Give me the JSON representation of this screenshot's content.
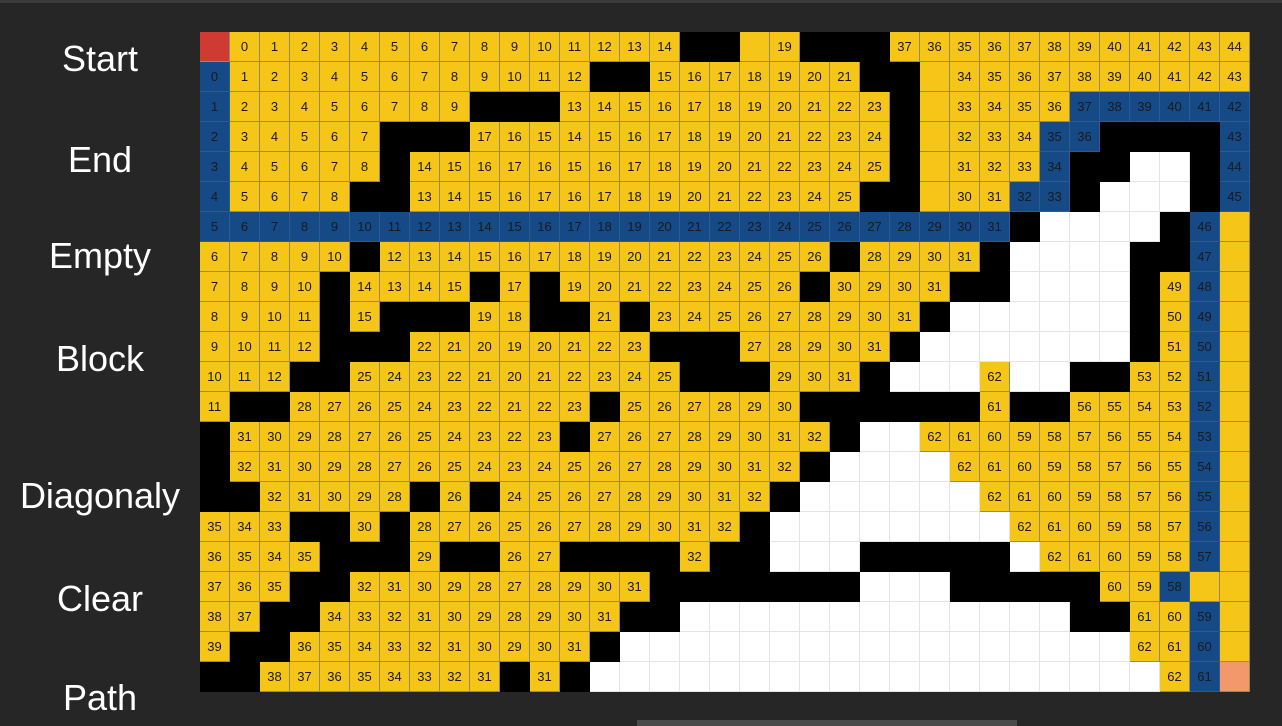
{
  "sidebar": {
    "start_label": "Start",
    "end_label": "End",
    "empty_label": "Empty",
    "block_label": "Block",
    "diagonaly_label": "Diagonaly",
    "clear_label": "Clear",
    "path_label": "Path"
  },
  "colors": {
    "empty": "#f5c518",
    "block": "#000000",
    "clear": "#ffffff",
    "path": "#154a86",
    "start": "#cf3a33",
    "end": "#f2986a",
    "background": "#262626"
  },
  "grid": {
    "cols": 35,
    "rows": 22,
    "legend": "S=start E=end #=block .=clear P=path-cell (value in path_values) otherwise number=empty cell with distance; values separated by commas",
    "cells": [
      "S,0,1,2,3,4,5,6,7,8,9,10,11,12,13,14,#,#,,19,#,#,#,37,36,35,36,37,38,39,40,41,42,43,44",
      "P0,1,2,3,4,5,6,7,8,9,10,11,12,#,#,15,16,17,18,19,20,21,#,#,,34,35,36,37,38,39,40,41,42,43,",
      "P1,2,3,4,5,6,7,8,9,#,#,#,13,14,15,16,17,18,19,20,21,22,23,#,,33,34,35,36,P37,P38,P39,P40,P41,P42,",
      "P2,3,4,5,6,7,#,#,#,17,16,15,14,15,16,17,18,19,20,21,22,23,24,#,,32,33,34,P35,P36,#,#,#,#,P43,",
      "P3,4,5,6,7,8,#,14,15,16,17,16,15,16,17,18,19,20,21,22,23,24,25,#,,31,32,33,P34,#,#,.,.,#,P44,",
      "P4,5,6,7,8,#,#,13,14,15,16,17,16,17,18,19,20,21,22,23,24,25,#,#,,30,31,P32,P33,#,.,.,.,#,P45,",
      "P5,P6,P7,P8,P9,P10,P11,P12,P13,P14,P15,P16,P17,P18,P19,P20,P21,P22,P23,P24,P25,P26,P27,P28,P29,P30,P31,#,.,.,.,.,#,P46,",
      "6,7,8,9,10,#,12,13,14,15,16,17,18,19,20,21,22,23,24,25,26,#,28,29,30,31,#,.,.,.,.,#,#,P47,",
      "7,8,9,10,#,14,13,14,15,#,17,#,19,20,21,22,23,24,25,26,#,30,29,30,31,#,#,.,.,.,.,#,49,P48,",
      "8,9,10,11,#,15,#,#,#,19,18,#,#,21,#,23,24,25,26,27,28,29,30,31,#,.,.,.,.,.,.,#,50,P49,",
      "9,10,11,12,#,#,#,22,21,20,19,20,21,22,23,#,#,#,27,28,29,30,31,#,.,.,.,.,.,.,.,#,51,P50,",
      "10,11,12,#,#,25,24,23,22,21,20,21,22,23,24,25,#,#,#,29,30,31,#,.,.,.,62,.,.,#,#,53,52,P51,",
      "11,#,#,28,27,26,25,24,23,22,21,22,23,#,25,26,27,28,29,30,#,#,#,#,#,#,61,#,#,56,55,54,53,P52,",
      "#,31,30,29,28,27,26,25,24,23,22,23,#,27,26,27,28,29,30,31,32,#,.,.,62,61,60,59,58,57,56,55,54,P53,",
      "#,32,31,30,29,28,27,26,25,24,23,24,25,26,27,28,29,30,31,32,#,.,.,.,.,62,61,60,59,58,57,56,55,P54,",
      "#,#,32,31,30,29,28,#,26,#,24,25,26,27,28,29,30,31,32,#,.,.,.,.,.,.,62,61,60,59,58,57,56,P55,",
      "35,34,33,#,#,30,#,28,27,26,25,26,27,28,29,30,31,32,#,.,.,.,.,.,.,.,.,62,61,60,59,58,57,P56,",
      "36,35,34,35,#,#,#,29,#,#,26,27,#,#,#,#,32,#,#,.,.,.,#,#,#,#,#,.,62,61,60,59,58,P57,",
      "37,36,35,#,#,32,31,30,29,28,27,28,29,30,31,#,#,#,#,#,#,#,.,.,.,#,#,#,#,#,60,59,P58,",
      "38,37,#,#,34,33,32,31,30,29,28,29,30,31,#,#,.,.,.,.,.,.,.,.,.,.,.,.,.,#,#,61,60,P59,",
      "39,#,#,36,35,34,33,32,31,30,29,30,31,#,.,.,.,.,.,.,.,.,.,.,.,.,.,.,.,.,.,62,61,P60,",
      "#,#,38,37,36,35,34,33,32,31,#,31,#,.,.,.,.,.,.,.,.,.,.,.,.,.,.,.,.,.,.,.,62,P61,E"
    ]
  }
}
